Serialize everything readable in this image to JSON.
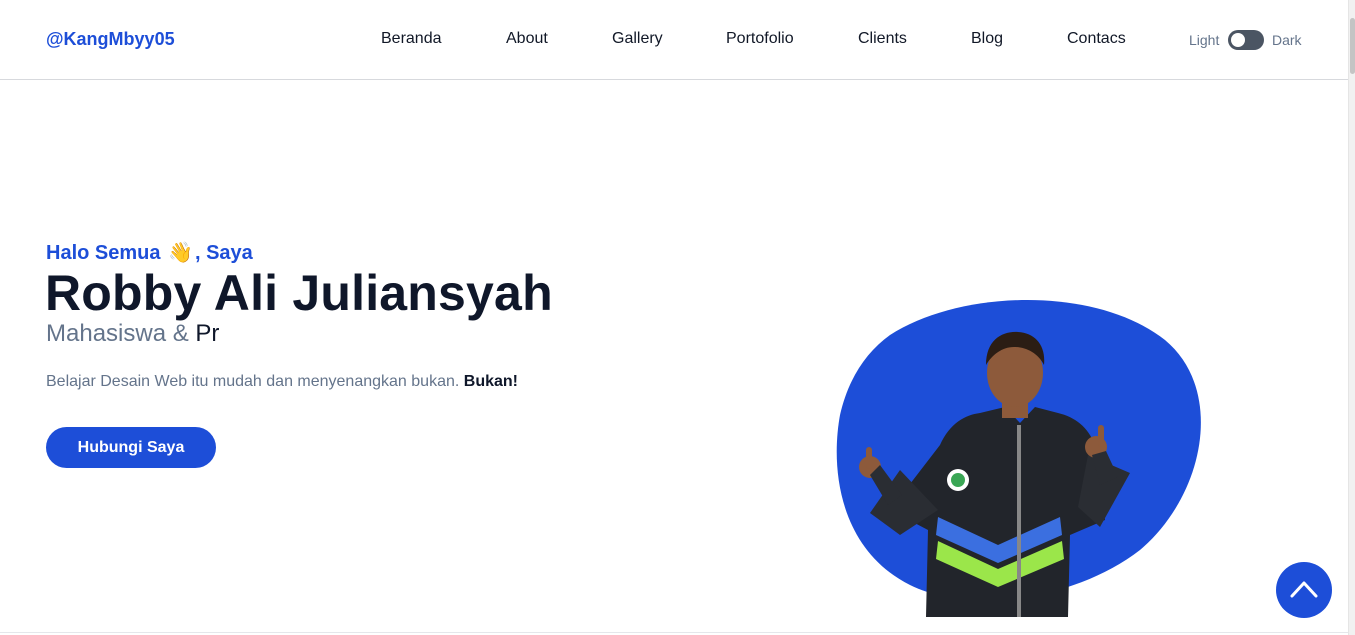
{
  "header": {
    "brand": "@KangMbyy05",
    "nav": [
      {
        "label": "Beranda",
        "name": "nav-beranda"
      },
      {
        "label": "About",
        "name": "nav-about"
      },
      {
        "label": "Gallery",
        "name": "nav-gallery"
      },
      {
        "label": "Portofolio",
        "name": "nav-portofolio"
      },
      {
        "label": "Clients",
        "name": "nav-clients"
      },
      {
        "label": "Blog",
        "name": "nav-blog"
      },
      {
        "label": "Contacs",
        "name": "nav-contacs"
      }
    ],
    "theme": {
      "light_label": "Light",
      "dark_label": "Dark"
    }
  },
  "hero": {
    "greeting_pre": "Halo Semua",
    "greeting_emoji": "👋",
    "greeting_post": ", Saya",
    "name": "Robby Ali Juliansyah",
    "role_static": "Mahasiswa &",
    "role_typed": "Pr",
    "description": "Belajar Desain Web itu mudah dan menyenangkan bukan.",
    "description_bold": "Bukan!",
    "cta_label": "Hubungi Saya"
  },
  "icons": {
    "back_to_top": "chevron-up-icon",
    "wave": "waving-hand-icon"
  },
  "colors": {
    "accent": "#1d4ed8",
    "text_dark": "#0f172a",
    "text_muted": "#64748b"
  }
}
